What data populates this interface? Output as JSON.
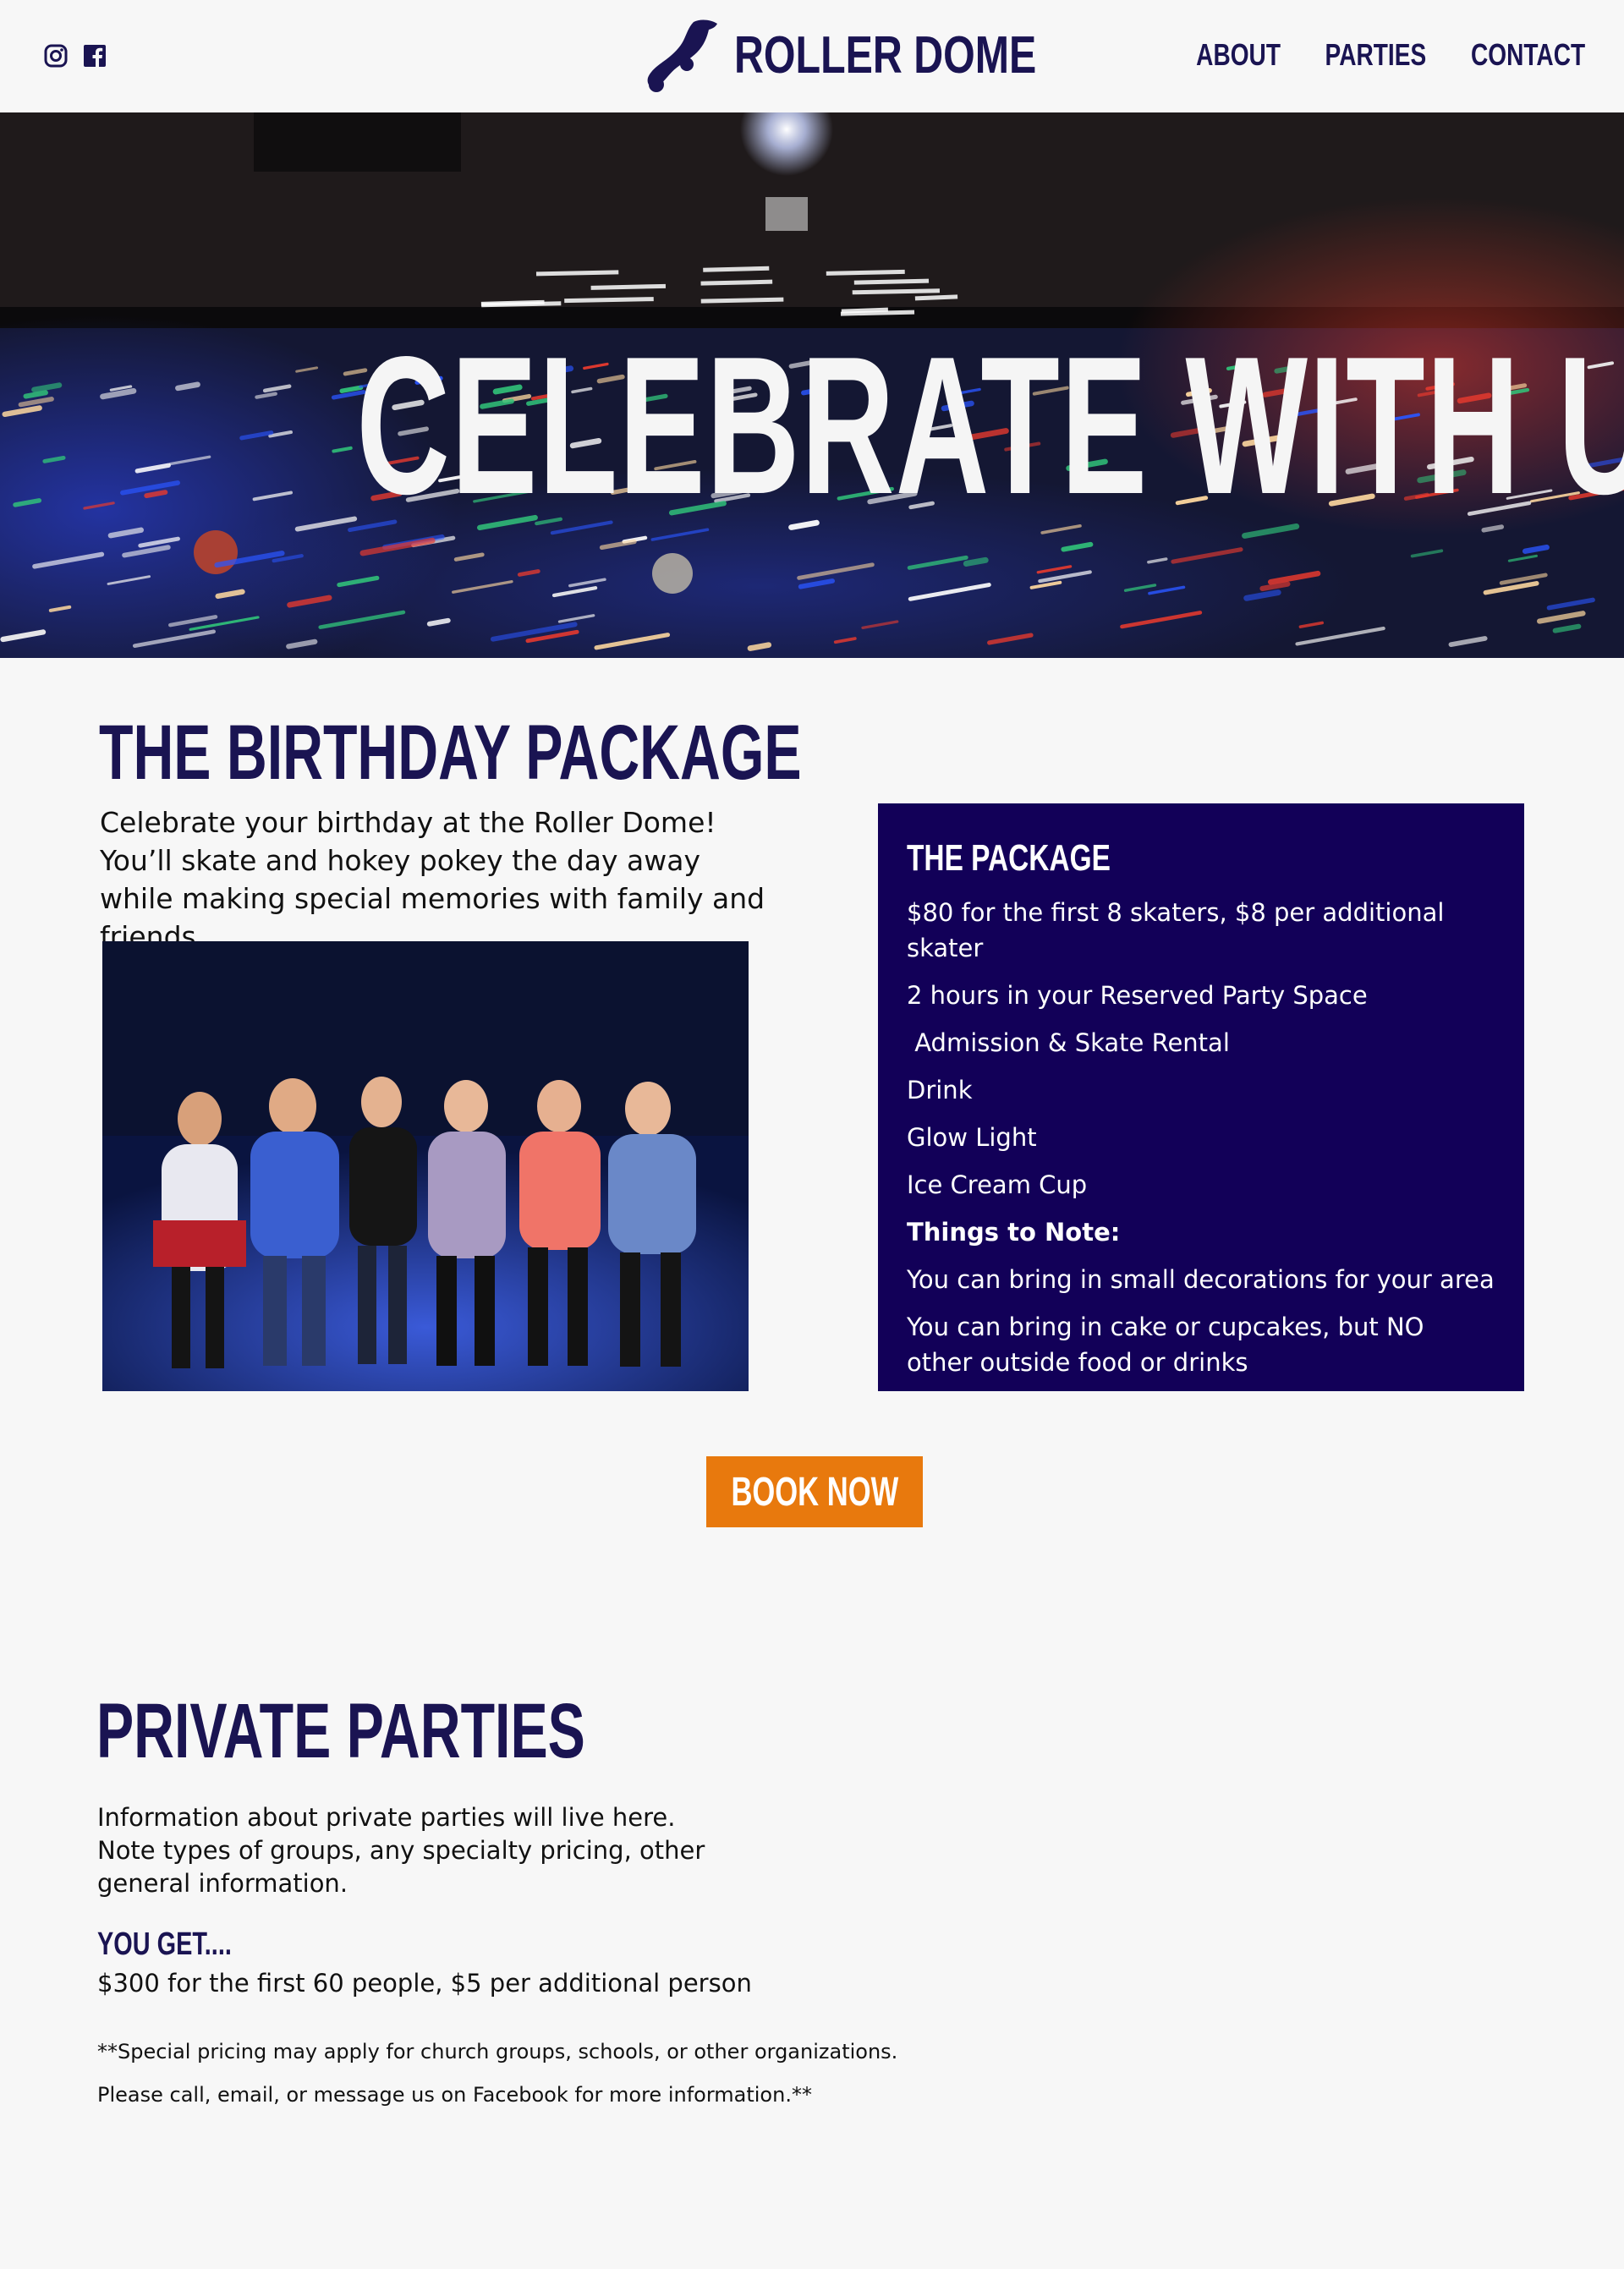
{
  "header": {
    "brand": "ROLLER DOME",
    "social": [
      "instagram-icon",
      "facebook-icon"
    ],
    "nav": [
      {
        "label": "ABOUT"
      },
      {
        "label": "PARTIES"
      },
      {
        "label": "CONTACT"
      }
    ]
  },
  "hero": {
    "title": "CELEBRATE WITH US"
  },
  "birthday": {
    "title": "THE BIRTHDAY PACKAGE",
    "description": "Celebrate your birthday at the Roller Dome! You’ll skate and hokey pokey the day away while making special memories with family and friends.",
    "package": {
      "title": "THE PACKAGE",
      "items": [
        "$80 for the first 8 skaters, $8 per additional skater",
        "2 hours in your Reserved Party Space",
        " Admission & Skate Rental",
        "Drink",
        "Glow Light",
        "Ice Cream Cup"
      ],
      "notes_heading": "Things to Note:",
      "notes": [
        "You can bring in small decorations for your area",
        "You can bring in cake or cupcakes, but NO other outside food or drinks"
      ]
    },
    "book_label": "BOOK NOW"
  },
  "private": {
    "title": "PRIVATE PARTIES",
    "description": "Information about private parties will live here. Note types of groups, any specialty pricing, other general information.",
    "you_get": "YOU GET....",
    "price": "$300 for the first 60 people, $5 per additional person",
    "note1": "**Special pricing may apply for church groups, schools, or other organizations.",
    "note2": "Please call, email, or message us on Facebook for more information.**"
  },
  "colors": {
    "brand_navy": "#1a1452",
    "package_bg": "#120058",
    "button_orange": "#e8790d",
    "page_bg": "#f7f7f7"
  }
}
